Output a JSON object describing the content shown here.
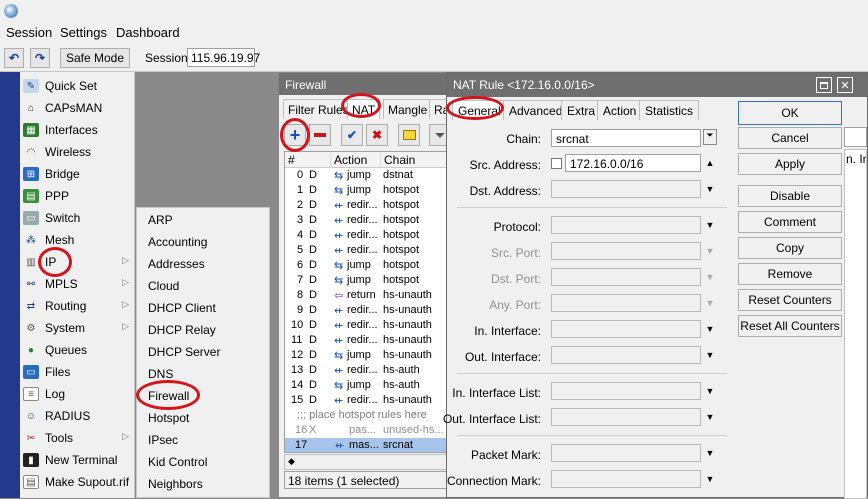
{
  "menu": {
    "session": "Session",
    "settings": "Settings",
    "dashboard": "Dashboard"
  },
  "toolbar": {
    "undo": "↶",
    "redo": "↷",
    "safe_mode": "Safe Mode",
    "session_label": "Session:",
    "session_value": "115.96.19.97"
  },
  "sidebar": {
    "items": [
      {
        "label": "Quick Set",
        "icon": "quickset-icon"
      },
      {
        "label": "CAPsMAN",
        "icon": "capsman-icon"
      },
      {
        "label": "Interfaces",
        "icon": "interfaces-icon"
      },
      {
        "label": "Wireless",
        "icon": "wireless-icon"
      },
      {
        "label": "Bridge",
        "icon": "bridge-icon"
      },
      {
        "label": "PPP",
        "icon": "ppp-icon"
      },
      {
        "label": "Switch",
        "icon": "switch-icon"
      },
      {
        "label": "Mesh",
        "icon": "mesh-icon"
      },
      {
        "label": "IP",
        "icon": "ip-icon"
      },
      {
        "label": "MPLS",
        "icon": "mpls-icon"
      },
      {
        "label": "Routing",
        "icon": "routing-icon"
      },
      {
        "label": "System",
        "icon": "system-icon"
      },
      {
        "label": "Queues",
        "icon": "queues-icon"
      },
      {
        "label": "Files",
        "icon": "files-icon"
      },
      {
        "label": "Log",
        "icon": "log-icon"
      },
      {
        "label": "RADIUS",
        "icon": "radius-icon"
      },
      {
        "label": "Tools",
        "icon": "tools-icon"
      },
      {
        "label": "New Terminal",
        "icon": "terminal-icon"
      },
      {
        "label": "Make Supout.rif",
        "icon": "supout-icon"
      }
    ]
  },
  "ip_submenu": {
    "items": [
      "ARP",
      "Accounting",
      "Addresses",
      "Cloud",
      "DHCP Client",
      "DHCP Relay",
      "DHCP Server",
      "DNS",
      "Firewall",
      "Hotspot",
      "IPsec",
      "Kid Control",
      "Neighbors"
    ]
  },
  "firewall": {
    "title": "Firewall",
    "tabs": [
      "Filter Rules",
      "NAT",
      "Mangle",
      "Ra"
    ],
    "columns": [
      "#",
      "Action",
      "Chain"
    ],
    "rows": [
      {
        "num": "0",
        "flag": "D",
        "action": "jump",
        "chain": "dstnat"
      },
      {
        "num": "1",
        "flag": "D",
        "action": "jump",
        "chain": "hotspot"
      },
      {
        "num": "2",
        "flag": "D",
        "action": "redir...",
        "chain": "hotspot"
      },
      {
        "num": "3",
        "flag": "D",
        "action": "redir...",
        "chain": "hotspot"
      },
      {
        "num": "4",
        "flag": "D",
        "action": "redir...",
        "chain": "hotspot"
      },
      {
        "num": "5",
        "flag": "D",
        "action": "redir...",
        "chain": "hotspot"
      },
      {
        "num": "6",
        "flag": "D",
        "action": "jump",
        "chain": "hotspot"
      },
      {
        "num": "7",
        "flag": "D",
        "action": "jump",
        "chain": "hotspot"
      },
      {
        "num": "8",
        "flag": "D",
        "action": "return",
        "chain": "hs-unauth"
      },
      {
        "num": "9",
        "flag": "D",
        "action": "redir...",
        "chain": "hs-unauth"
      },
      {
        "num": "10",
        "flag": "D",
        "action": "redir...",
        "chain": "hs-unauth"
      },
      {
        "num": "11",
        "flag": "D",
        "action": "redir...",
        "chain": "hs-unauth"
      },
      {
        "num": "12",
        "flag": "D",
        "action": "jump",
        "chain": "hs-unauth"
      },
      {
        "num": "13",
        "flag": "D",
        "action": "redir...",
        "chain": "hs-auth"
      },
      {
        "num": "14",
        "flag": "D",
        "action": "jump",
        "chain": "hs-auth"
      },
      {
        "num": "15",
        "flag": "D",
        "action": "redir...",
        "chain": "hs-unauth"
      }
    ],
    "comment": ";;; place hotspot rules here",
    "row16": {
      "num": "16",
      "flag": "X",
      "action": "pas...",
      "chain": "unused-hs..."
    },
    "row17": {
      "num": "17",
      "flag": "",
      "action": "mas...",
      "chain": "srcnat"
    },
    "status": "18 items (1 selected)"
  },
  "nat_rule": {
    "title": "NAT Rule <172.16.0.0/16>",
    "tabs": [
      "General",
      "Advanced",
      "Extra",
      "Action",
      "Statistics"
    ],
    "fields": {
      "chain_label": "Chain:",
      "chain_value": "srcnat",
      "src_address_label": "Src. Address:",
      "src_address_value": "172.16.0.0/16",
      "dst_address_label": "Dst. Address:",
      "protocol_label": "Protocol:",
      "src_port_label": "Src. Port:",
      "dst_port_label": "Dst. Port:",
      "any_port_label": "Any. Port:",
      "in_interface_label": "In. Interface:",
      "out_interface_label": "Out. Interface:",
      "in_interface_list_label": "In. Interface List:",
      "out_interface_list_label": "Out. Interface List:",
      "packet_mark_label": "Packet Mark:",
      "connection_mark_label": "Connection Mark:"
    },
    "buttons": [
      "OK",
      "Cancel",
      "Apply",
      "Disable",
      "Comment",
      "Copy",
      "Remove",
      "Reset Counters",
      "Reset All Counters"
    ],
    "behind_text": "n. In"
  }
}
